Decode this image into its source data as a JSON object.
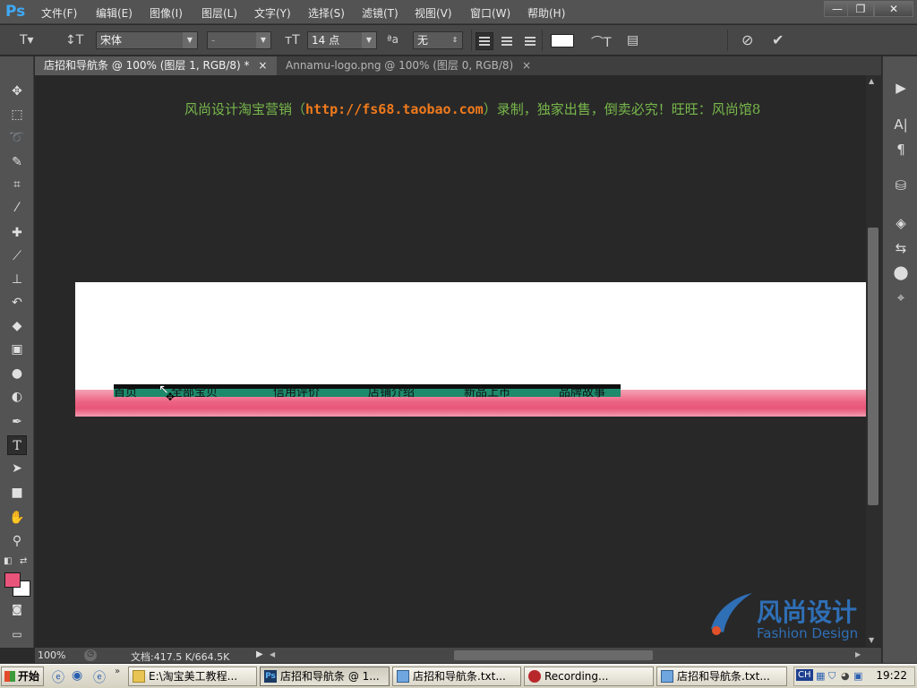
{
  "app": {
    "logo": "Ps"
  },
  "menu": [
    "文件(F)",
    "编辑(E)",
    "图像(I)",
    "图层(L)",
    "文字(Y)",
    "选择(S)",
    "滤镜(T)",
    "视图(V)",
    "窗口(W)",
    "帮助(H)"
  ],
  "window_controls": {
    "minimize": "—",
    "restore": "❐",
    "close": "✕"
  },
  "options": {
    "font_family": "宋体",
    "font_style": "-",
    "font_size": "14 点",
    "antialias_icon": "ªa",
    "antialias": "无",
    "text_color": "#ffffff"
  },
  "tabs": [
    {
      "label": "店招和导航条 @ 100% (图层 1, RGB/8) *",
      "close": "×"
    },
    {
      "label": "Annamu-logo.png @ 100% (图层 0, RGB/8)",
      "close": "×"
    }
  ],
  "canvas": {
    "banner_text_before": "风尚设计淘宝营销（",
    "banner_url": "http://fs68.taobao.com",
    "banner_text_after": "）录制，独家出售，倒卖必究！旺旺：风尚馆8",
    "nav_items": [
      "首页",
      "全部宝贝",
      "信用评价",
      "店铺介绍",
      "新品上市",
      "品牌故事"
    ],
    "colors": {
      "pink": "#e85679",
      "green": "#1d8a6c",
      "foreground": "#e9557a",
      "background": "#ffffff"
    }
  },
  "status": {
    "zoom": "100%",
    "doc_info": "文档:417.5 K/664.5K"
  },
  "watermark": {
    "cn": "风尚设计",
    "en": "Fashion Design"
  },
  "taskbar": {
    "start": "开始",
    "tasks": [
      "E:\\淘宝美工教程...",
      "店招和导航条 @ 1...",
      "店招和导航条.txt...",
      "Recording...",
      "店招和导航条.txt..."
    ],
    "tray_lang": "CH",
    "clock": "19:22"
  }
}
